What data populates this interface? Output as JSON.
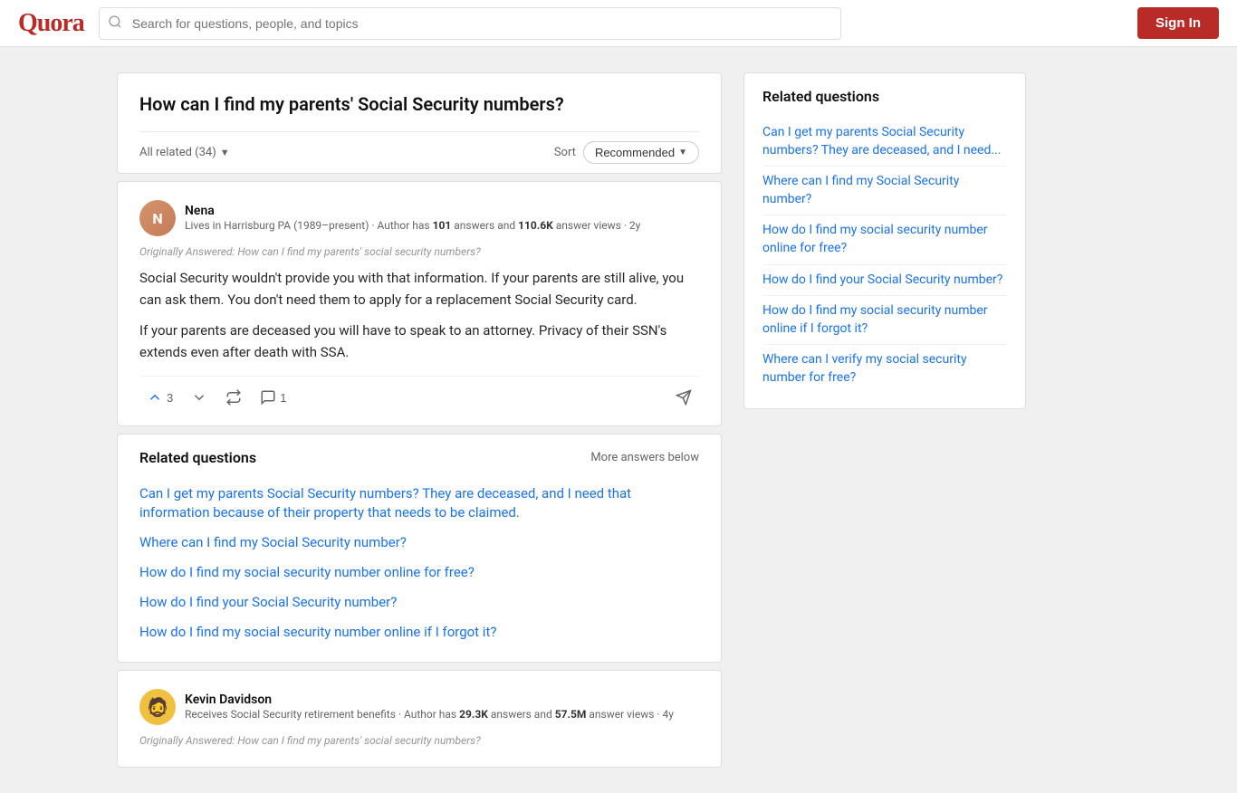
{
  "header": {
    "logo": "Quora",
    "search_placeholder": "Search for questions, people, and topics",
    "sign_in_label": "Sign In"
  },
  "question": {
    "title": "How can I find my parents' Social Security numbers?"
  },
  "sort_bar": {
    "all_related": "All related (34)",
    "sort_label": "Sort",
    "recommended": "Recommended"
  },
  "answers": [
    {
      "author_name": "Nena",
      "author_bio": "Lives in Harrisburg PA (1989–present) · Author has",
      "answers_count": "101",
      "bio_mid": "answers and",
      "views_count": "110.6K",
      "bio_end": "answer views · 2y",
      "originally_answered": "Originally Answered: How can I find my parents' social security numbers?",
      "answer_p1": "Social Security wouldn't provide you with that information. If your parents are still alive, you can ask them. You don't need them to apply for a replacement Social Security card.",
      "answer_p2": "If your parents are deceased you will have to speak to an attorney. Privacy of their SSN's extends even after death with SSA.",
      "upvote_count": "3",
      "comment_count": "1"
    },
    {
      "author_name": "Kevin Davidson",
      "author_bio": "Receives Social Security retirement benefits · Author has",
      "answers_count": "29.3K",
      "bio_mid": "answers and",
      "views_count": "57.5M",
      "bio_end": "answer views · 4y",
      "originally_answered": "Originally Answered: How can I find my parents' social security numbers?"
    }
  ],
  "related_inline": {
    "title": "Related questions",
    "more_answers": "More answers below",
    "links": [
      "Can I get my parents Social Security numbers? They are deceased, and I need that information because of their property that needs to be claimed.",
      "Where can I find my Social Security number?",
      "How do I find my social security number online for free?",
      "How do I find your Social Security number?",
      "How do I find my social security number online if I forgot it?"
    ]
  },
  "sidebar": {
    "title": "Related questions",
    "links": [
      "Can I get my parents Social Security numbers? They are deceased, and I need...",
      "Where can I find my Social Security number?",
      "How do I find my social security number online for free?",
      "How do I find your Social Security number?",
      "How do I find my social security number online if I forgot it?",
      "Where can I verify my social security number for free?"
    ]
  }
}
